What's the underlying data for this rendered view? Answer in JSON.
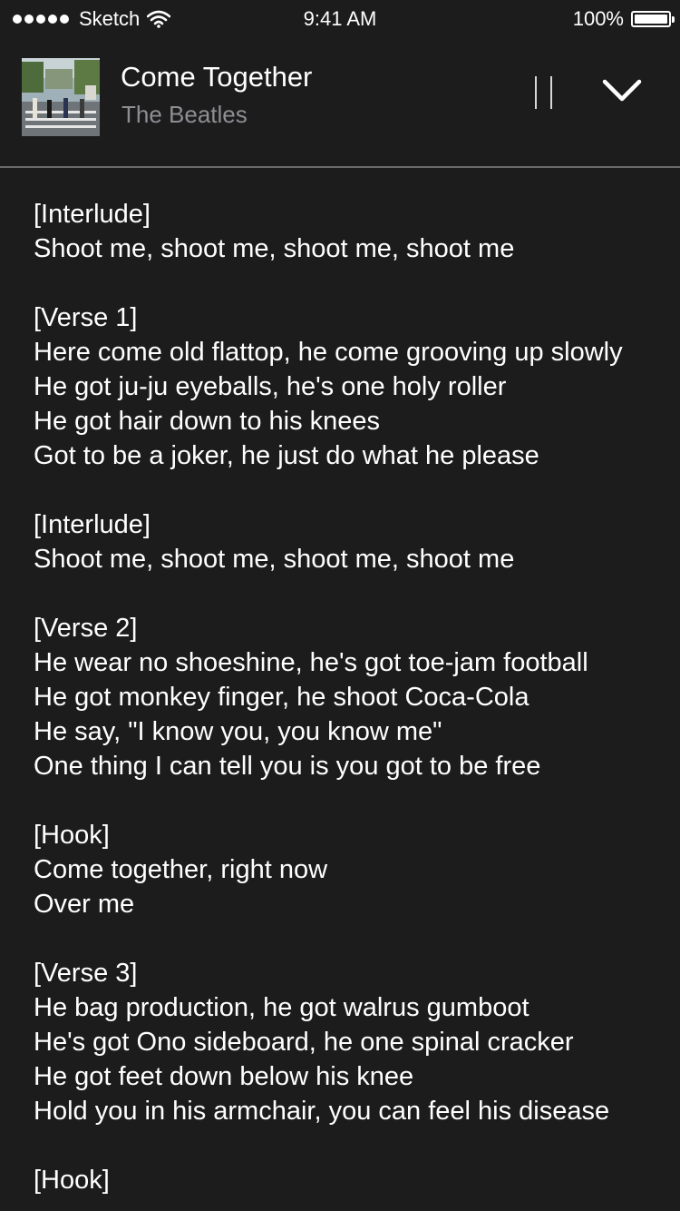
{
  "status_bar": {
    "carrier": "Sketch",
    "time": "9:41 AM",
    "battery": "100%"
  },
  "now_playing": {
    "title": "Come Together",
    "artist": "The Beatles"
  },
  "lyrics": [
    {
      "lines": [
        "[Interlude]",
        "Shoot me, shoot me, shoot me, shoot me"
      ]
    },
    {
      "lines": [
        "[Verse 1]",
        "Here come old flattop, he come grooving up slowly",
        "He got ju-ju eyeballs, he's one holy roller",
        "He got hair down to his knees",
        "Got to be a joker, he just do what he please"
      ]
    },
    {
      "lines": [
        "[Interlude]",
        "Shoot me, shoot me, shoot me, shoot me"
      ]
    },
    {
      "lines": [
        "[Verse 2]",
        "He wear no shoeshine, he's got toe-jam football",
        "He got monkey finger, he shoot Coca-Cola",
        "He say, \"I know you, you know me\"",
        "One thing I can tell you is you got to be free"
      ]
    },
    {
      "lines": [
        "[Hook]",
        "Come together, right now",
        "Over me"
      ]
    },
    {
      "lines": [
        "[Verse 3]",
        "He bag production, he got walrus gumboot",
        "He's got Ono sideboard, he one spinal cracker",
        "He got feet down below his knee",
        "Hold you in his armchair, you can feel his disease"
      ]
    },
    {
      "lines": [
        "[Hook]"
      ]
    }
  ]
}
